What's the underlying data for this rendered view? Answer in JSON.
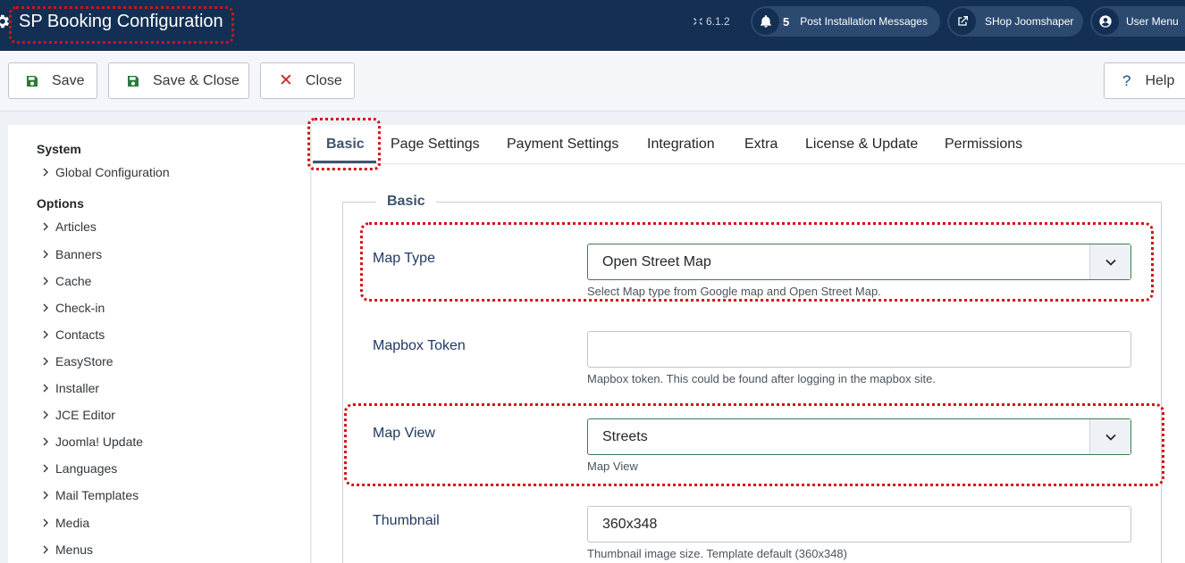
{
  "header": {
    "title": "SP Booking Configuration",
    "version": "6.1.2",
    "notifications": {
      "count": "5",
      "label": "Post Installation Messages"
    },
    "site_link": "SHop Joomshaper",
    "user_menu": "User Menu"
  },
  "toolbar": {
    "save": "Save",
    "save_close": "Save & Close",
    "close": "Close",
    "help": "Help"
  },
  "sidebar": {
    "system_heading": "System",
    "system_items": [
      "Global Configuration"
    ],
    "options_heading": "Options",
    "options_items": [
      "Articles",
      "Banners",
      "Cache",
      "Check-in",
      "Contacts",
      "EasyStore",
      "Installer",
      "JCE Editor",
      "Joomla! Update",
      "Languages",
      "Mail Templates",
      "Media",
      "Menus"
    ]
  },
  "tabs": [
    "Basic",
    "Page Settings",
    "Payment Settings",
    "Integration",
    "Extra",
    "License & Update",
    "Permissions"
  ],
  "fieldset": {
    "legend": "Basic",
    "fields": {
      "map_type": {
        "label": "Map Type",
        "value": "Open Street Map",
        "description": "Select Map type from Google map and Open Street Map."
      },
      "mapbox_token": {
        "label": "Mapbox Token",
        "value": "",
        "description": "Mapbox token. This could be found after logging in the mapbox site."
      },
      "map_view": {
        "label": "Map View",
        "value": "Streets",
        "description": "Map View"
      },
      "thumbnail": {
        "label": "Thumbnail",
        "value": "360x348",
        "description": "Thumbnail image size. Template default (360x348)"
      }
    }
  },
  "colors": {
    "header_bg": "#132f53",
    "highlight": "#d21414",
    "accent": "#3d5570",
    "select_border": "#3f7d4e"
  },
  "icons": [
    "gear-icon",
    "joomla-icon",
    "bell-icon",
    "external-link-icon",
    "user-icon",
    "save-icon",
    "close-icon",
    "help-icon",
    "chevron-right-icon",
    "chevron-down-icon"
  ]
}
